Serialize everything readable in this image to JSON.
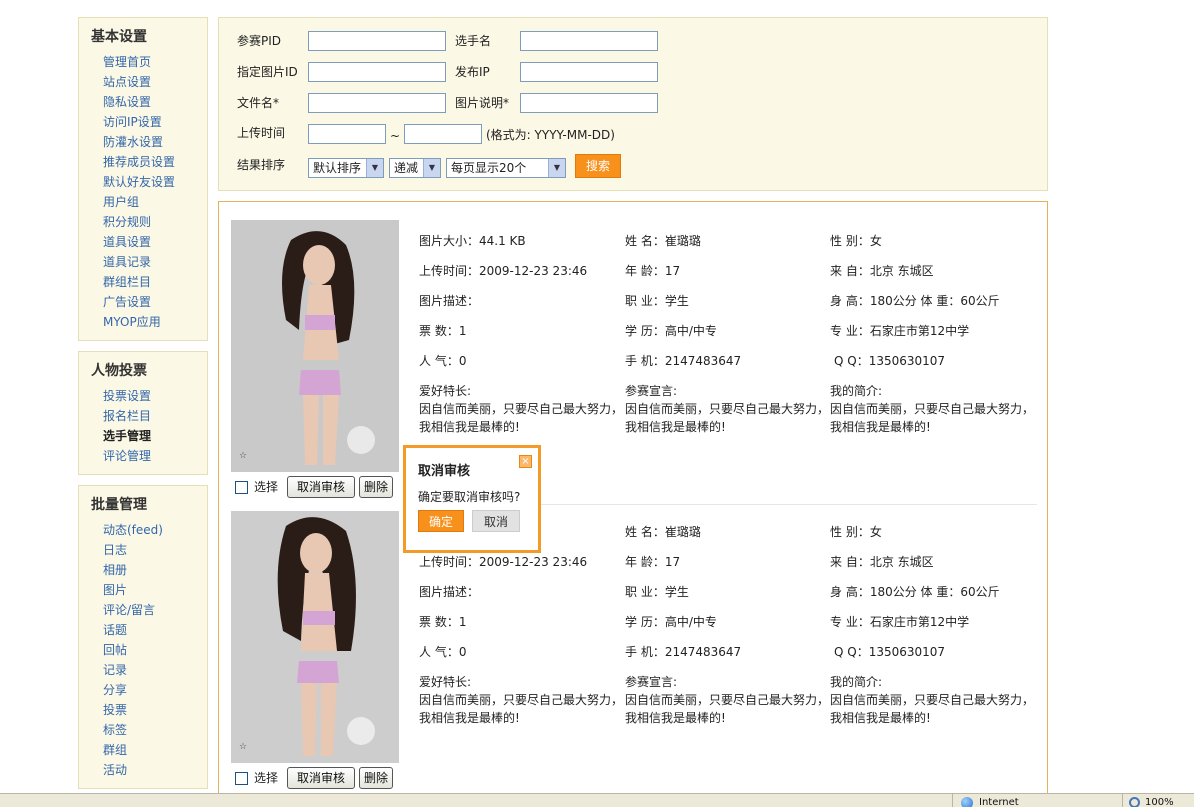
{
  "sidebar": {
    "groups": [
      {
        "title": "基本设置",
        "items": [
          "管理首页",
          "站点设置",
          "隐私设置",
          "访问IP设置",
          "防灌水设置",
          "推荐成员设置",
          "默认好友设置",
          "用户组",
          "积分规则",
          "道具设置",
          "道具记录",
          "群组栏目",
          "广告设置",
          "MYOP应用"
        ]
      },
      {
        "title": "人物投票",
        "items": [
          "投票设置",
          "报名栏目",
          "选手管理",
          "评论管理"
        ]
      },
      {
        "title": "批量管理",
        "items": [
          "动态(feed)",
          "日志",
          "相册",
          "图片",
          "评论/留言",
          "话题",
          "回帖",
          "记录",
          "分享",
          "投票",
          "标签",
          "群组",
          "活动"
        ]
      }
    ]
  },
  "search": {
    "pid_label": "参赛PID",
    "player_label": "选手名",
    "pic_id_label": "指定图片ID",
    "ip_label": "发布IP",
    "filename_label": "文件名*",
    "pic_desc_label": "图片说明*",
    "upload_time_label": "上传时间",
    "range_sep": "~",
    "date_format_hint": "(格式为: YYYY-MM-DD)",
    "sort_label": "结果排序",
    "sort_select": "默认排序",
    "order_select": "递减",
    "perpage_select": "每页显示20个",
    "search_button": "搜索"
  },
  "entries": [
    {
      "select_label": "选择",
      "cancel_review_label": "取消审核",
      "delete_label": "删除",
      "size": "图片大小：44.1 KB",
      "upload_time": "上传时间：2009-12-23 23:46",
      "pic_desc": "图片描述：",
      "votes": "票 数：1",
      "popularity": "人 气：0",
      "name": "姓 名：崔璐璐",
      "age": "年 龄：17",
      "job": "职 业：学生",
      "education": "学 历：高中/中专",
      "phone": "手 机：2147483647",
      "gender": "性 别：女",
      "from": "来 自：北京  东城区",
      "height_weight": "身 高：180公分  体 重：60公斤",
      "major": "专 业：石家庄市第12中学",
      "qq": "Q Q：1350630107",
      "hobby_label": "爱好特长:",
      "hobby_text": "因自信而美丽，只要尽自己最大努力，我相信我是最棒的!",
      "declaration_label": "参赛宣言:",
      "declaration_text": "因自信而美丽，只要尽自己最大努力，我相信我是最棒的!",
      "intro_label": "我的简介:",
      "intro_text": "因自信而美丽，只要尽自己最大努力，我相信我是最棒的!"
    },
    {
      "select_label": "选择",
      "cancel_review_label": "取消审核",
      "delete_label": "删除",
      "size": "",
      "upload_time": "上传时间：2009-12-23 23:46",
      "pic_desc": "图片描述：",
      "votes": "票 数：1",
      "popularity": "人 气：0",
      "name": "姓 名：崔璐璐",
      "age": "年 龄：17",
      "job": "职 业：学生",
      "education": "学 历：高中/中专",
      "phone": "手 机：2147483647",
      "gender": "性 别：女",
      "from": "来 自：北京  东城区",
      "height_weight": "身 高：180公分  体 重：60公斤",
      "major": "专 业：石家庄市第12中学",
      "qq": "Q Q：1350630107",
      "hobby_label": "爱好特长:",
      "hobby_text": "因自信而美丽，只要尽自己最大努力，我相信我是最棒的!",
      "declaration_label": "参赛宣言:",
      "declaration_text": "因自信而美丽，只要尽自己最大努力，我相信我是最棒的!",
      "intro_label": "我的简介:",
      "intro_text": "因自信而美丽，只要尽自己最大努力，我相信我是最棒的!"
    }
  ],
  "popup": {
    "title": "取消审核",
    "message": "确定要取消审核吗?",
    "ok_label": "确定",
    "cancel_label": "取消",
    "close_glyph": "×"
  },
  "statusbar": {
    "zone": "Internet",
    "zoom": "100%"
  },
  "colors": {
    "accent": "#f8901c",
    "panel_bg": "#fbf8e6",
    "link": "#3366aa"
  }
}
